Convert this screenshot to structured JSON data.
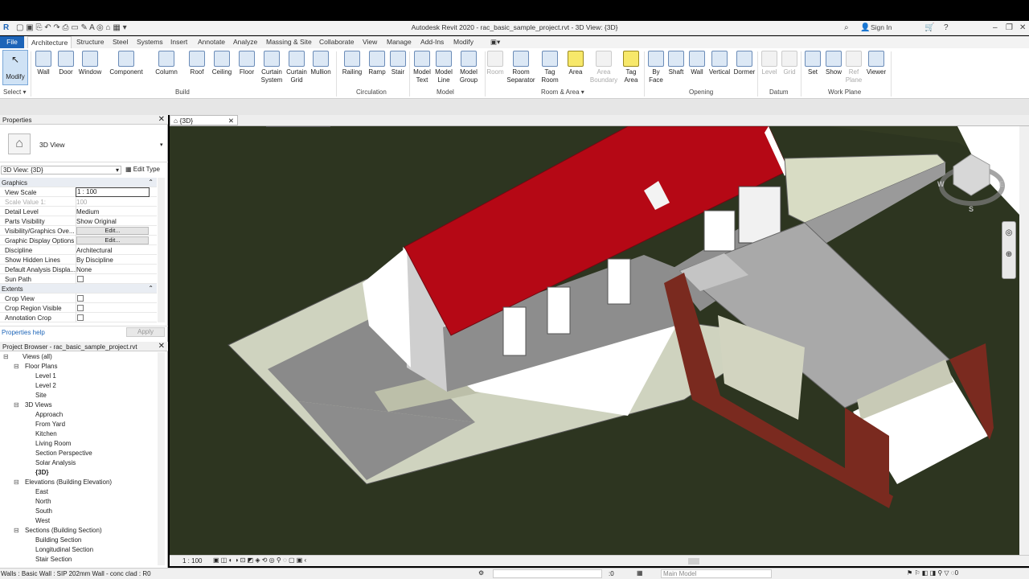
{
  "titlebar": {
    "title": "Autodesk Revit 2020 - rac_basic_sample_project.rvt - 3D View: {3D}",
    "sign_in": "Sign In"
  },
  "tabs": [
    "File",
    "Architecture",
    "Structure",
    "Steel",
    "Systems",
    "Insert",
    "Annotate",
    "Analyze",
    "Massing & Site",
    "Collaborate",
    "View",
    "Manage",
    "Add-Ins",
    "Modify"
  ],
  "ribbon": {
    "modify": "Modify",
    "select": "Select",
    "build": [
      "Wall",
      "Door",
      "Window",
      "Component",
      "Column",
      "Roof",
      "Ceiling",
      "Floor",
      "Curtain System",
      "Curtain Grid",
      "Mullion"
    ],
    "circulation": [
      "Railing",
      "Ramp",
      "Stair"
    ],
    "model": [
      "Model Text",
      "Model Line",
      "Model Group"
    ],
    "room_area": [
      "Room",
      "Room Separator",
      "Tag Room",
      "Area",
      "Area Boundary",
      "Tag Area"
    ],
    "opening": [
      "By Face",
      "Shaft",
      "Wall",
      "Vertical",
      "Dormer"
    ],
    "datum": [
      "Level",
      "Grid"
    ],
    "work_plane": [
      "Set",
      "Show",
      "Ref Plane",
      "Viewer"
    ],
    "groups": [
      "Build",
      "Circulation",
      "Model",
      "Room & Area",
      "Opening",
      "Datum",
      "Work Plane"
    ]
  },
  "properties": {
    "title": "Properties",
    "type_name": "3D View",
    "selector": "3D View: {3D}",
    "edit_type": "Edit Type",
    "rows": [
      {
        "k": "Graphics",
        "v": "",
        "section": true
      },
      {
        "k": "View Scale",
        "v": "1 : 100"
      },
      {
        "k": "Scale Value    1:",
        "v": "100"
      },
      {
        "k": "Detail Level",
        "v": "Medium"
      },
      {
        "k": "Parts Visibility",
        "v": "Show Original"
      },
      {
        "k": "Visibility/Graphics Ove...",
        "v": "Edit...",
        "btn": true
      },
      {
        "k": "Graphic Display Options",
        "v": "Edit...",
        "btn": true
      },
      {
        "k": "Discipline",
        "v": "Architectural"
      },
      {
        "k": "Show Hidden Lines",
        "v": "By Discipline"
      },
      {
        "k": "Default Analysis Displa...",
        "v": "None"
      },
      {
        "k": "Sun Path",
        "v": "",
        "cb": true
      },
      {
        "k": "Extents",
        "v": "",
        "section": true
      },
      {
        "k": "Crop View",
        "v": "",
        "cb": true
      },
      {
        "k": "Crop Region Visible",
        "v": "",
        "cb": true
      },
      {
        "k": "Annotation Crop",
        "v": "",
        "cb": true
      }
    ],
    "help": "Properties help",
    "apply": "Apply"
  },
  "browser": {
    "title": "Project Browser - rac_basic_sample_project.rvt",
    "items": [
      {
        "t": "Views (all)",
        "l": 0
      },
      {
        "t": "Floor Plans",
        "l": 1
      },
      {
        "t": "Level 1",
        "l": 2
      },
      {
        "t": "Level 2",
        "l": 2
      },
      {
        "t": "Site",
        "l": 2
      },
      {
        "t": "3D Views",
        "l": 1
      },
      {
        "t": "Approach",
        "l": 2
      },
      {
        "t": "From Yard",
        "l": 2
      },
      {
        "t": "Kitchen",
        "l": 2
      },
      {
        "t": "Living Room",
        "l": 2
      },
      {
        "t": "Section Perspective",
        "l": 2
      },
      {
        "t": "Solar Analysis",
        "l": 2
      },
      {
        "t": "{3D}",
        "l": 2,
        "bold": true
      },
      {
        "t": "Elevations (Building Elevation)",
        "l": 1
      },
      {
        "t": "East",
        "l": 2
      },
      {
        "t": "North",
        "l": 2
      },
      {
        "t": "South",
        "l": 2
      },
      {
        "t": "West",
        "l": 2
      },
      {
        "t": "Sections (Building Section)",
        "l": 1
      },
      {
        "t": "Building Section",
        "l": 2
      },
      {
        "t": "Longitudinal Section",
        "l": 2
      },
      {
        "t": "Stair Section",
        "l": 2
      }
    ]
  },
  "view_tab": "{3D}",
  "viewcube": {
    "w": "W",
    "e": "E",
    "s": "S"
  },
  "view_bar": {
    "scale": "1 : 100"
  },
  "status": {
    "text": "Walls : Basic Wall : SIP 202mm Wall - conc clad : R0",
    "zero": ":0",
    "model": "Main Model"
  }
}
